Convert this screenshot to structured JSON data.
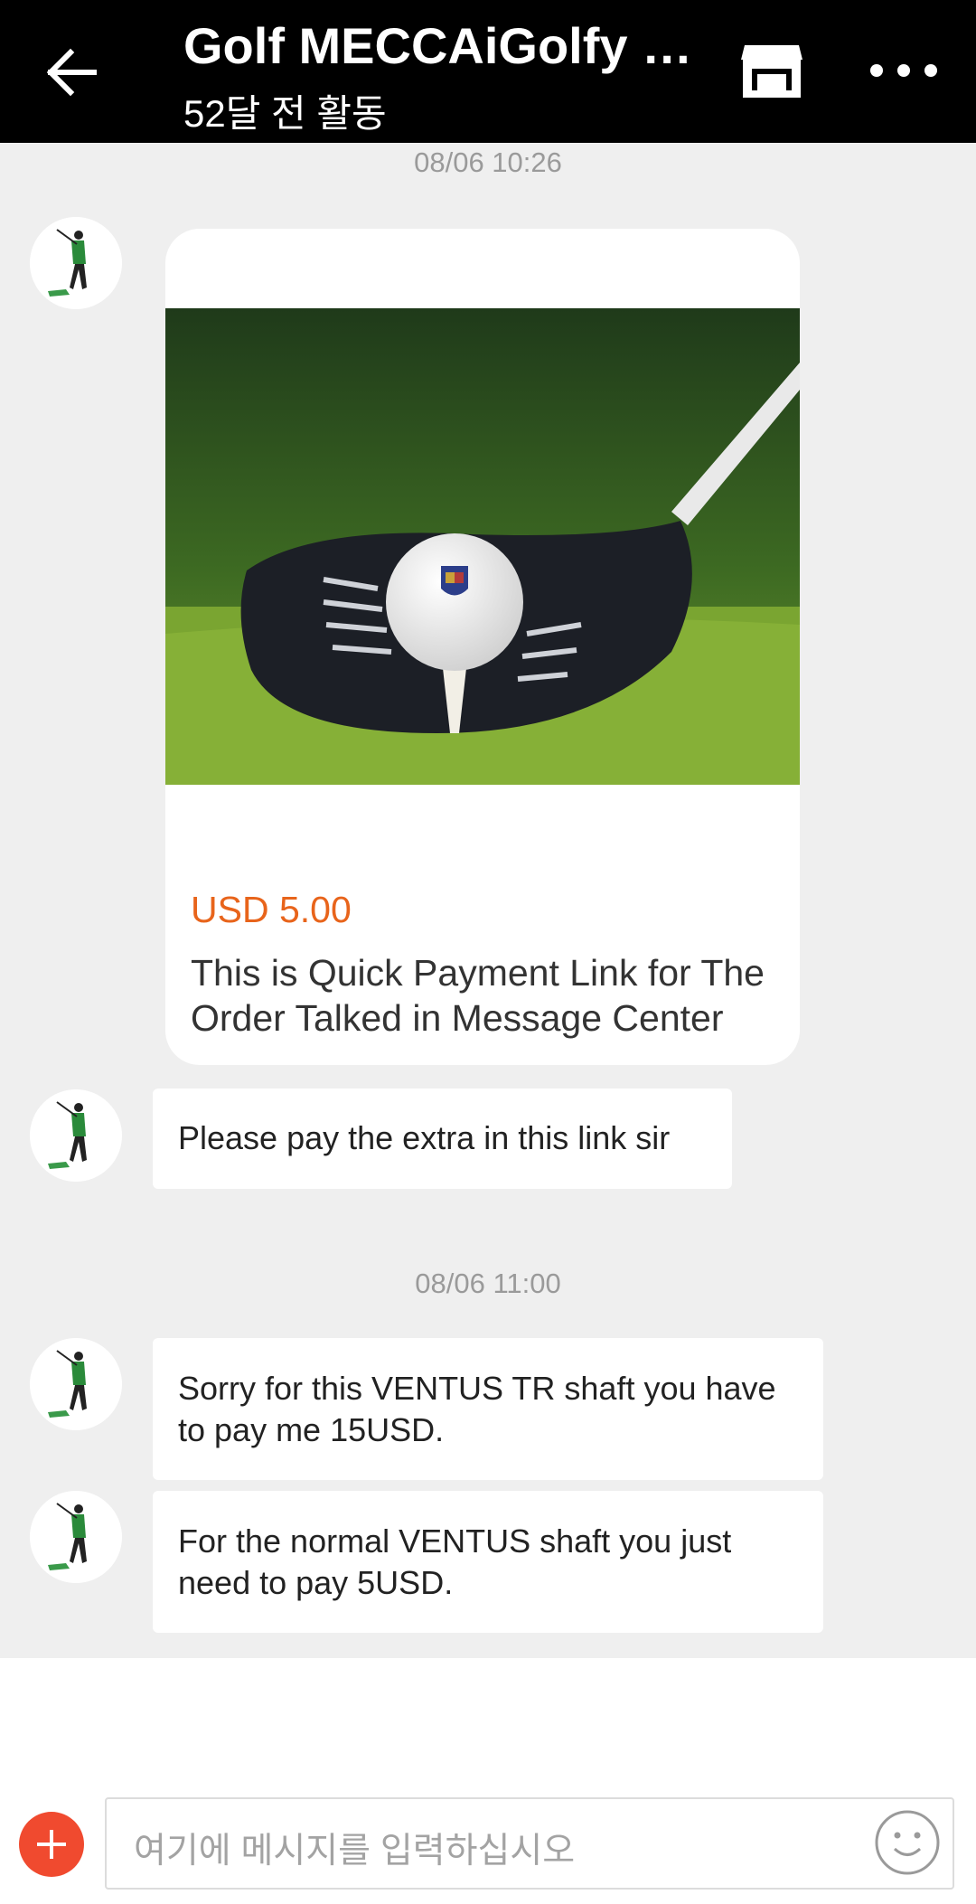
{
  "header": {
    "title": "Golf MECCAiGolfy Store",
    "subtitle": "52달 전 활동"
  },
  "messages": {
    "ts1": "08/06 10:26",
    "product": {
      "price": "USD 5.00",
      "description": "This is Quick Payment Link for The Order Talked in Message Center"
    },
    "msg1": "Please pay the extra in this link sir",
    "ts2": "08/06 11:00",
    "msg2": "Sorry for this VENTUS TR shaft you have to pay me 15USD.",
    "msg3": "For the normal VENTUS shaft you just need to pay 5USD."
  },
  "input": {
    "placeholder": "여기에 메시지를 입력하십시오"
  },
  "icons": {
    "back": "arrow-left-icon",
    "store": "store-icon",
    "more": "more-dots-icon",
    "plus": "plus-icon",
    "emoji": "smiley-icon"
  },
  "colors": {
    "header_bg": "#000000",
    "price": "#e8641b",
    "plus_button": "#f04a2f"
  }
}
